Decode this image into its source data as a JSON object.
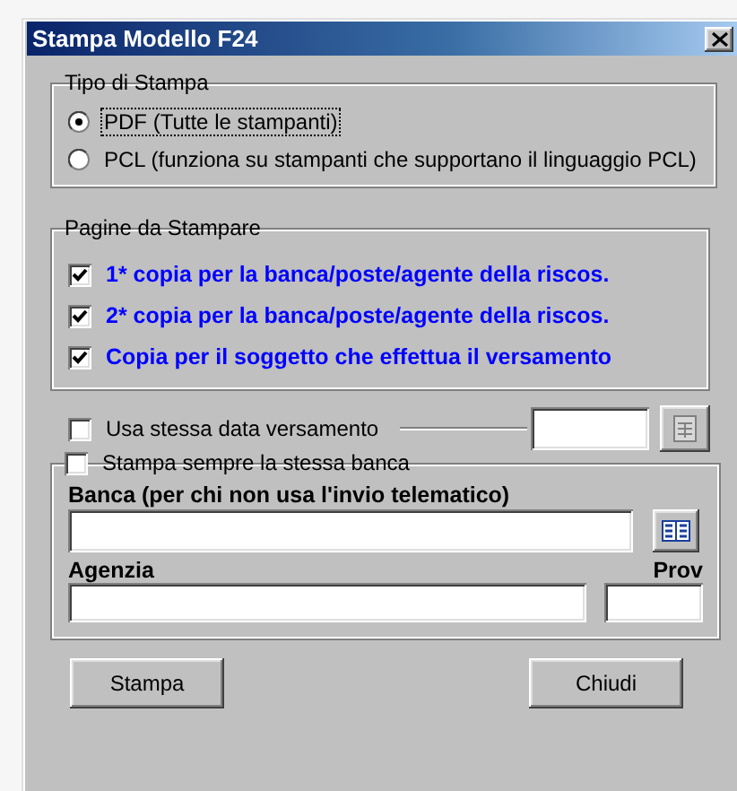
{
  "window": {
    "title": "Stampa Modello F24"
  },
  "print_type": {
    "legend": "Tipo di Stampa",
    "options": [
      {
        "label": "PDF (Tutte le stampanti)",
        "selected": true,
        "focused": true
      },
      {
        "label": "PCL (funziona su stampanti che supportano il linguaggio PCL)",
        "selected": false,
        "focused": false
      }
    ]
  },
  "pages": {
    "legend": "Pagine da Stampare",
    "items": [
      {
        "label": "1* copia per la banca/poste/agente della riscos.",
        "checked": true
      },
      {
        "label": "2* copia per la banca/poste/agente della riscos.",
        "checked": true
      },
      {
        "label": "Copia per il soggetto che effettua il versamento",
        "checked": true
      }
    ]
  },
  "same_date": {
    "label": "Usa stessa data versamento",
    "checked": false
  },
  "same_bank": {
    "label": "Stampa sempre la stessa banca",
    "checked": false,
    "bank_label": "Banca (per chi non usa l'invio telematico)",
    "agency_label": "Agenzia",
    "prov_label": "Prov"
  },
  "buttons": [
    "Stampa",
    "Chiudi"
  ]
}
